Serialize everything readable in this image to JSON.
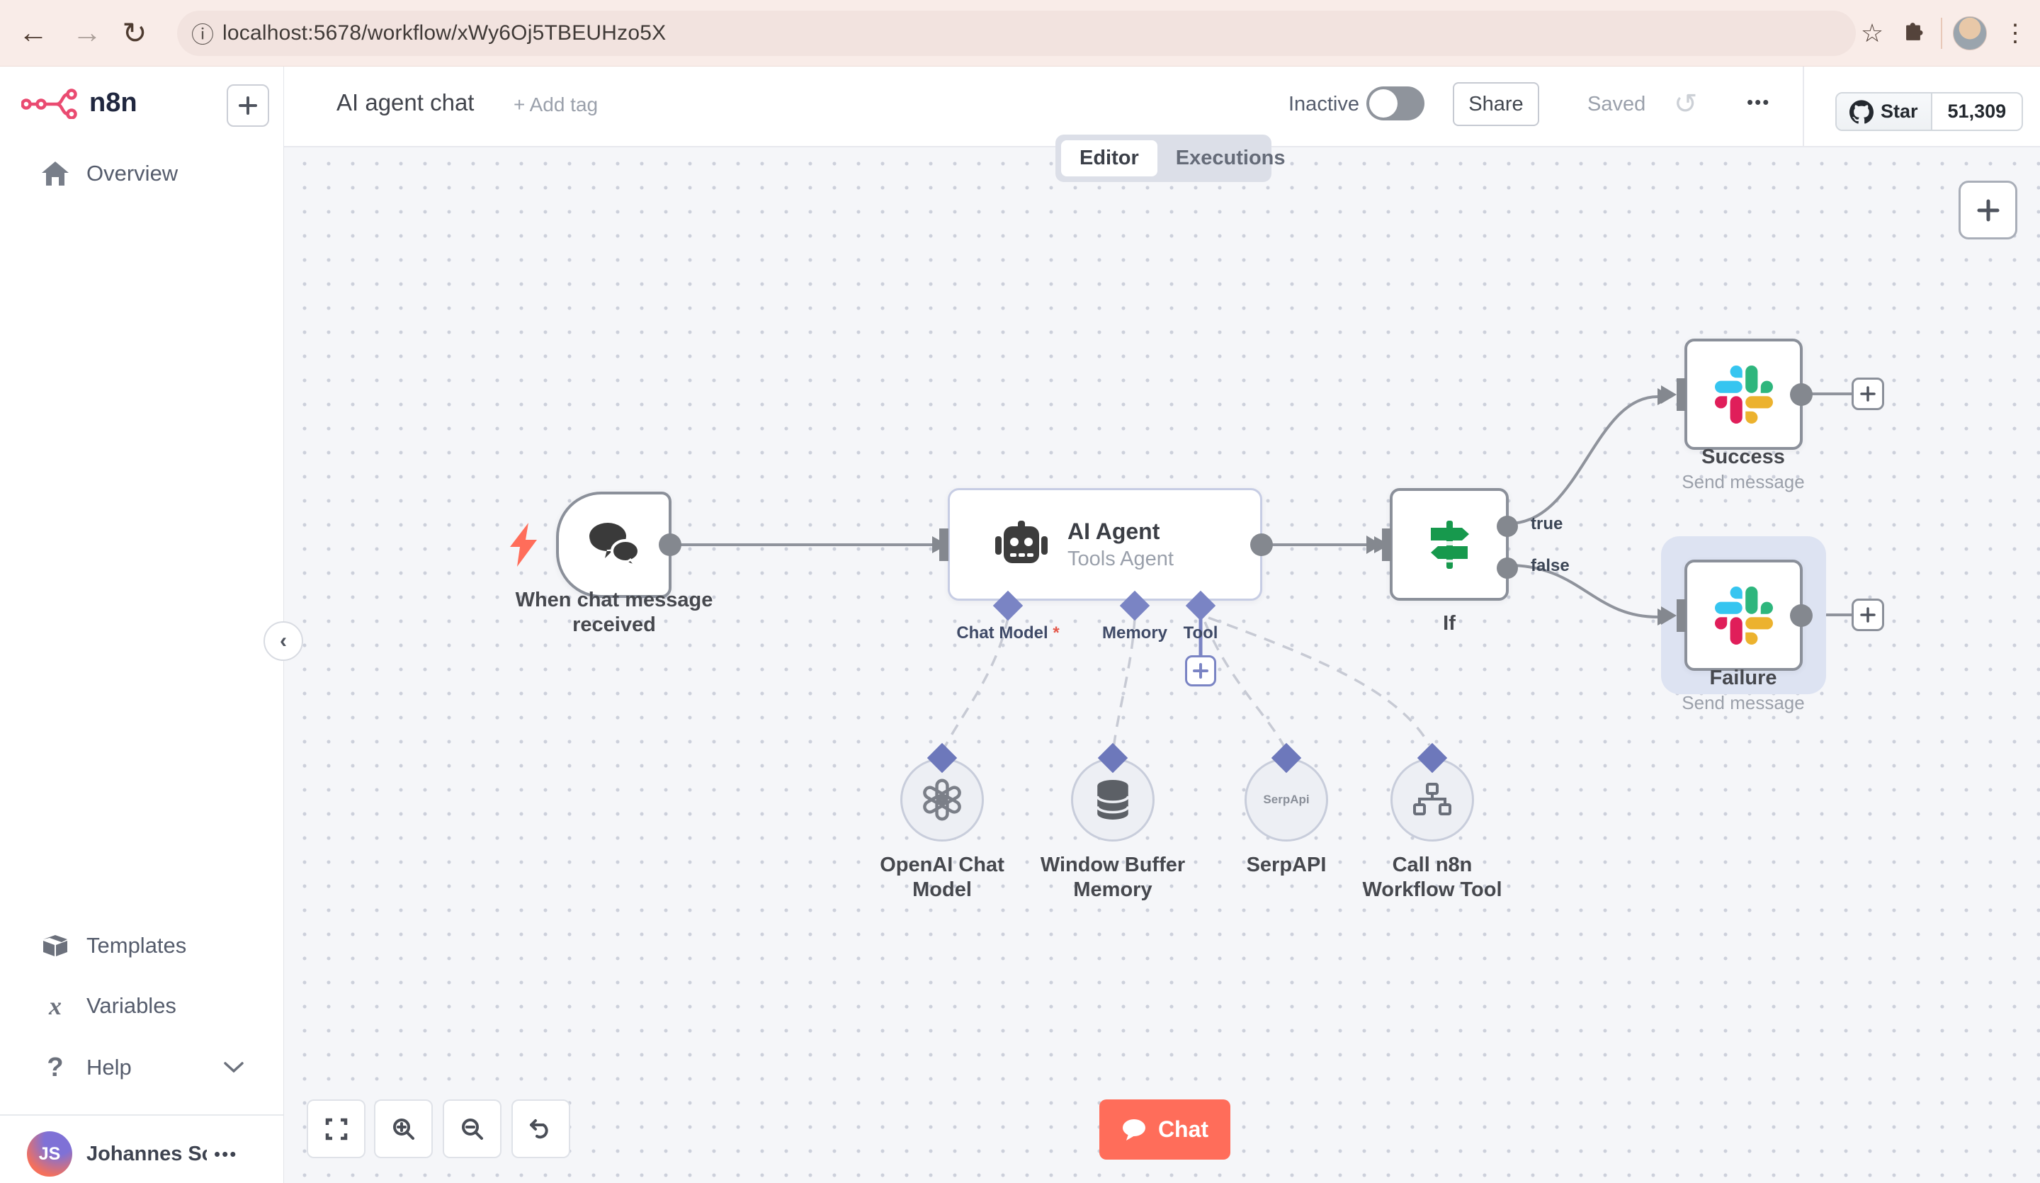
{
  "browser": {
    "url": "localhost:5678/workflow/xWy6Oj5TBEUHzo5X"
  },
  "sidebar": {
    "logo": "n8n",
    "overview": "Overview",
    "templates": "Templates",
    "variables": "Variables",
    "variables_icon": "x",
    "help": "Help",
    "help_icon": "?",
    "user": {
      "initials": "JS",
      "name": "Johannes Schn...",
      "menu": "•••"
    }
  },
  "header": {
    "title": "AI agent chat",
    "add_tag": "+ Add tag",
    "inactive": "Inactive",
    "share": "Share",
    "saved": "Saved",
    "menu": "•••",
    "github_star": "Star",
    "github_count": "51,309"
  },
  "tabs": {
    "editor": "Editor",
    "executions": "Executions"
  },
  "canvas": {
    "trigger": {
      "label_line1": "When chat message",
      "label_line2": "received"
    },
    "agent": {
      "title": "AI Agent",
      "subtitle": "Tools Agent",
      "ports": {
        "chat_model": "Chat Model",
        "required_mark": "*",
        "memory": "Memory",
        "tool": "Tool"
      }
    },
    "if_node": {
      "label": "If",
      "true_label": "true",
      "false_label": "false"
    },
    "success": {
      "label": "Success",
      "subtitle": "Send message"
    },
    "failure": {
      "label": "Failure",
      "subtitle": "Send message"
    },
    "subnodes": {
      "openai": {
        "label_line1": "OpenAI Chat",
        "label_line2": "Model"
      },
      "memory": {
        "label_line1": "Window Buffer",
        "label_line2": "Memory"
      },
      "serpapi": {
        "label": "SerpAPI",
        "icon_text": "SerpApi"
      },
      "call_n8n": {
        "label_line1": "Call n8n",
        "label_line2": "Workflow Tool"
      }
    },
    "chat_button": "Chat",
    "colors": {
      "accent": "#ff6d5a",
      "diamond": "#7a84c4",
      "node_border": "#8b909a",
      "if_green": "#17994d",
      "slack_blue": "#36C5F0",
      "slack_green": "#2EB67D",
      "slack_yellow": "#ECB22E",
      "slack_red": "#E01E5A"
    }
  }
}
